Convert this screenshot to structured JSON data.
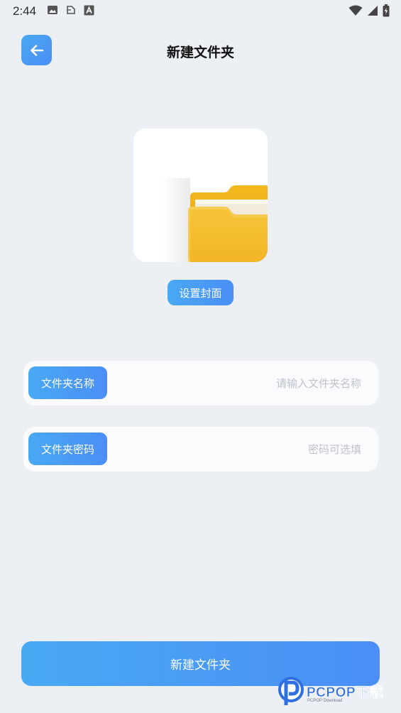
{
  "status_bar": {
    "time": "2:44"
  },
  "header": {
    "title": "新建文件夹"
  },
  "cover": {
    "button_label": "设置封面"
  },
  "form": {
    "name_label": "文件夹名称",
    "name_placeholder": "请输入文件夹名称",
    "password_label": "文件夹密码",
    "password_placeholder": "密码可选填"
  },
  "submit": {
    "label": "新建文件夹"
  },
  "watermark": {
    "brand": "PCPOP下载",
    "sub": "PCPOP Download"
  },
  "colors": {
    "accent_start": "#49A9F3",
    "accent_end": "#4A8EF6",
    "background": "#ECEFF3",
    "folder": "#F3B92A"
  }
}
